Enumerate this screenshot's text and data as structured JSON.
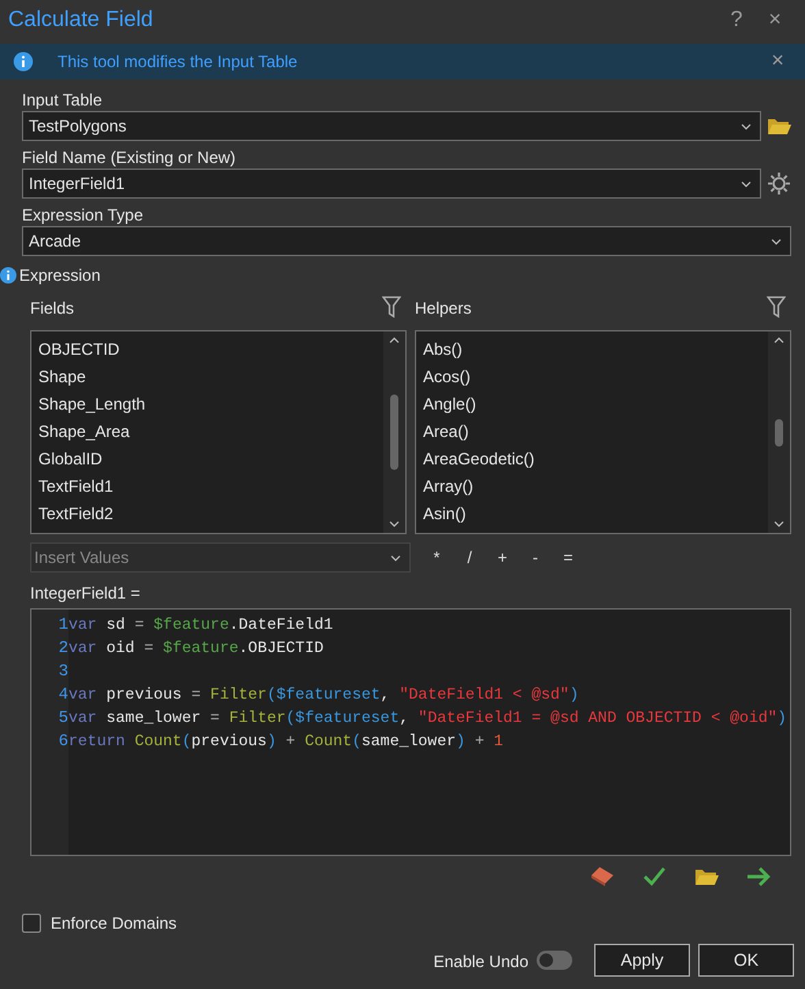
{
  "window": {
    "title": "Calculate Field",
    "help": "?",
    "close": "×"
  },
  "banner": {
    "text": "This tool modifies the Input Table",
    "close": "×"
  },
  "params": [
    {
      "label": "Input Table",
      "value": "TestPolygons",
      "kind": "folder"
    },
    {
      "label": "Field Name (Existing or New)",
      "value": "IntegerField1",
      "kind": "gear"
    },
    {
      "label": "Expression Type",
      "value": "Arcade",
      "kind": "plain"
    }
  ],
  "expression": {
    "label": "Expression",
    "fields": {
      "title": "Fields",
      "items": [
        "OBJECTID",
        "Shape",
        "Shape_Length",
        "Shape_Area",
        "GlobalID",
        "TextField1",
        "TextField2"
      ]
    },
    "helpers": {
      "title": "Helpers",
      "items": [
        "Abs()",
        "Acos()",
        "Angle()",
        "Area()",
        "AreaGeodetic()",
        "Array()",
        "Asin()"
      ]
    },
    "insert_values": {
      "placeholder": "Insert Values"
    },
    "operators": [
      "*",
      "/",
      "+",
      "-",
      "="
    ],
    "target": "IntegerField1 =",
    "code": [
      {
        "number": "1",
        "tokens": [
          {
            "kind": "keyword",
            "text": "var"
          },
          {
            "kind": "plain",
            "text": " sd "
          },
          {
            "kind": "op",
            "text": "= "
          },
          {
            "kind": "global",
            "text": "$feature"
          },
          {
            "kind": "plain",
            "text": ".DateField1"
          }
        ]
      },
      {
        "number": "2",
        "tokens": [
          {
            "kind": "keyword",
            "text": "var"
          },
          {
            "kind": "plain",
            "text": " oid "
          },
          {
            "kind": "op",
            "text": "= "
          },
          {
            "kind": "global",
            "text": "$feature"
          },
          {
            "kind": "plain",
            "text": ".OBJECTID"
          }
        ]
      },
      {
        "number": "3"
      },
      {
        "number": "4",
        "tokens": [
          {
            "kind": "keyword",
            "text": "var"
          },
          {
            "kind": "plain",
            "text": " previous "
          },
          {
            "kind": "op",
            "text": "= "
          },
          {
            "kind": "func",
            "text": "Filter"
          },
          {
            "kind": "paren",
            "text": "($featureset"
          },
          {
            "kind": "plain",
            "text": ", "
          },
          {
            "kind": "string",
            "text": "\"DateField1 < @sd\""
          },
          {
            "kind": "paren",
            "text": ")"
          }
        ]
      },
      {
        "number": "5",
        "tokens": [
          {
            "kind": "keyword",
            "text": "var"
          },
          {
            "kind": "plain",
            "text": " same_lower "
          },
          {
            "kind": "op",
            "text": "= "
          },
          {
            "kind": "func",
            "text": "Filter"
          },
          {
            "kind": "paren",
            "text": "($featureset"
          },
          {
            "kind": "plain",
            "text": ", "
          },
          {
            "kind": "string",
            "text": "\"DateField1 = @sd AND OBJECTID < @oid\""
          },
          {
            "kind": "paren",
            "text": ")"
          }
        ]
      },
      {
        "number": "6",
        "tokens": [
          {
            "kind": "keyword",
            "text": "return "
          },
          {
            "kind": "func",
            "text": "Count"
          },
          {
            "kind": "paren",
            "text": "("
          },
          {
            "kind": "plain",
            "text": "previous"
          },
          {
            "kind": "paren",
            "text": ")"
          },
          {
            "kind": "op",
            "text": " + "
          },
          {
            "kind": "func",
            "text": "Count"
          },
          {
            "kind": "paren",
            "text": "("
          },
          {
            "kind": "plain",
            "text": "same_lower"
          },
          {
            "kind": "paren",
            "text": ")"
          },
          {
            "kind": "op",
            "text": " + "
          },
          {
            "kind": "number",
            "text": "1"
          }
        ]
      }
    ]
  },
  "tools": [
    {
      "kind": "eraser"
    },
    {
      "kind": "check"
    },
    {
      "kind": "folder"
    },
    {
      "kind": "arrow"
    }
  ],
  "enforce_domains": {
    "label": "Enforce Domains",
    "checked": false
  },
  "enable_undo": {
    "label": "Enable Undo",
    "on": false
  },
  "buttons": [
    "Apply",
    "OK"
  ]
}
